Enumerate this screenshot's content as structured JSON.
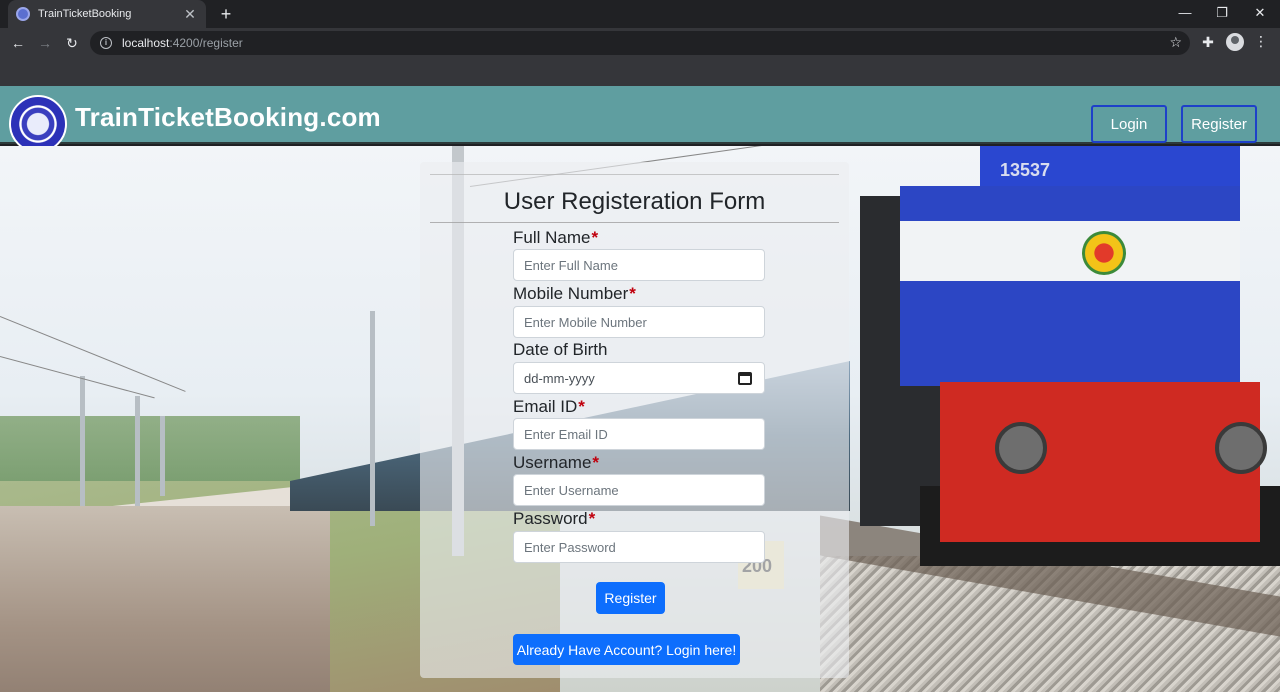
{
  "browser": {
    "tab_title": "TrainTicketBooking",
    "new_tab": "+",
    "url_host": "localhost",
    "url_rest": ":4200/register",
    "window_controls": [
      "—",
      "❐",
      "✕"
    ],
    "icons": [
      "back-icon",
      "forward-icon",
      "reload-icon",
      "info-icon",
      "star-icon",
      "extensions-icon",
      "profile-icon",
      "menu-icon"
    ]
  },
  "navbar": {
    "brand": "TrainTicketBooking.com",
    "login_label": "Login",
    "register_label": "Register",
    "color": "#5f9ea0"
  },
  "hero": {
    "loco_number": "13537",
    "milestone": "200"
  },
  "form": {
    "title": "User Registeration Form",
    "required_mark": "*",
    "fields": [
      {
        "label": "Full Name",
        "required": true,
        "placeholder": "Enter Full Name"
      },
      {
        "label": "Mobile Number",
        "required": true,
        "placeholder": "Enter Mobile Number"
      },
      {
        "label": "Date of Birth",
        "required": false,
        "placeholder": "dd-mm-yyyy"
      },
      {
        "label": "Email ID",
        "required": true,
        "placeholder": "Enter Email ID"
      },
      {
        "label": "Username",
        "required": true,
        "placeholder": "Enter Username"
      },
      {
        "label": "Password",
        "required": true,
        "placeholder": "Enter Password"
      }
    ],
    "submit_label": "Register",
    "login_link_label": "Already Have Account? Login here!",
    "accent": "#0d6efd",
    "required_color": "#c0000d"
  }
}
